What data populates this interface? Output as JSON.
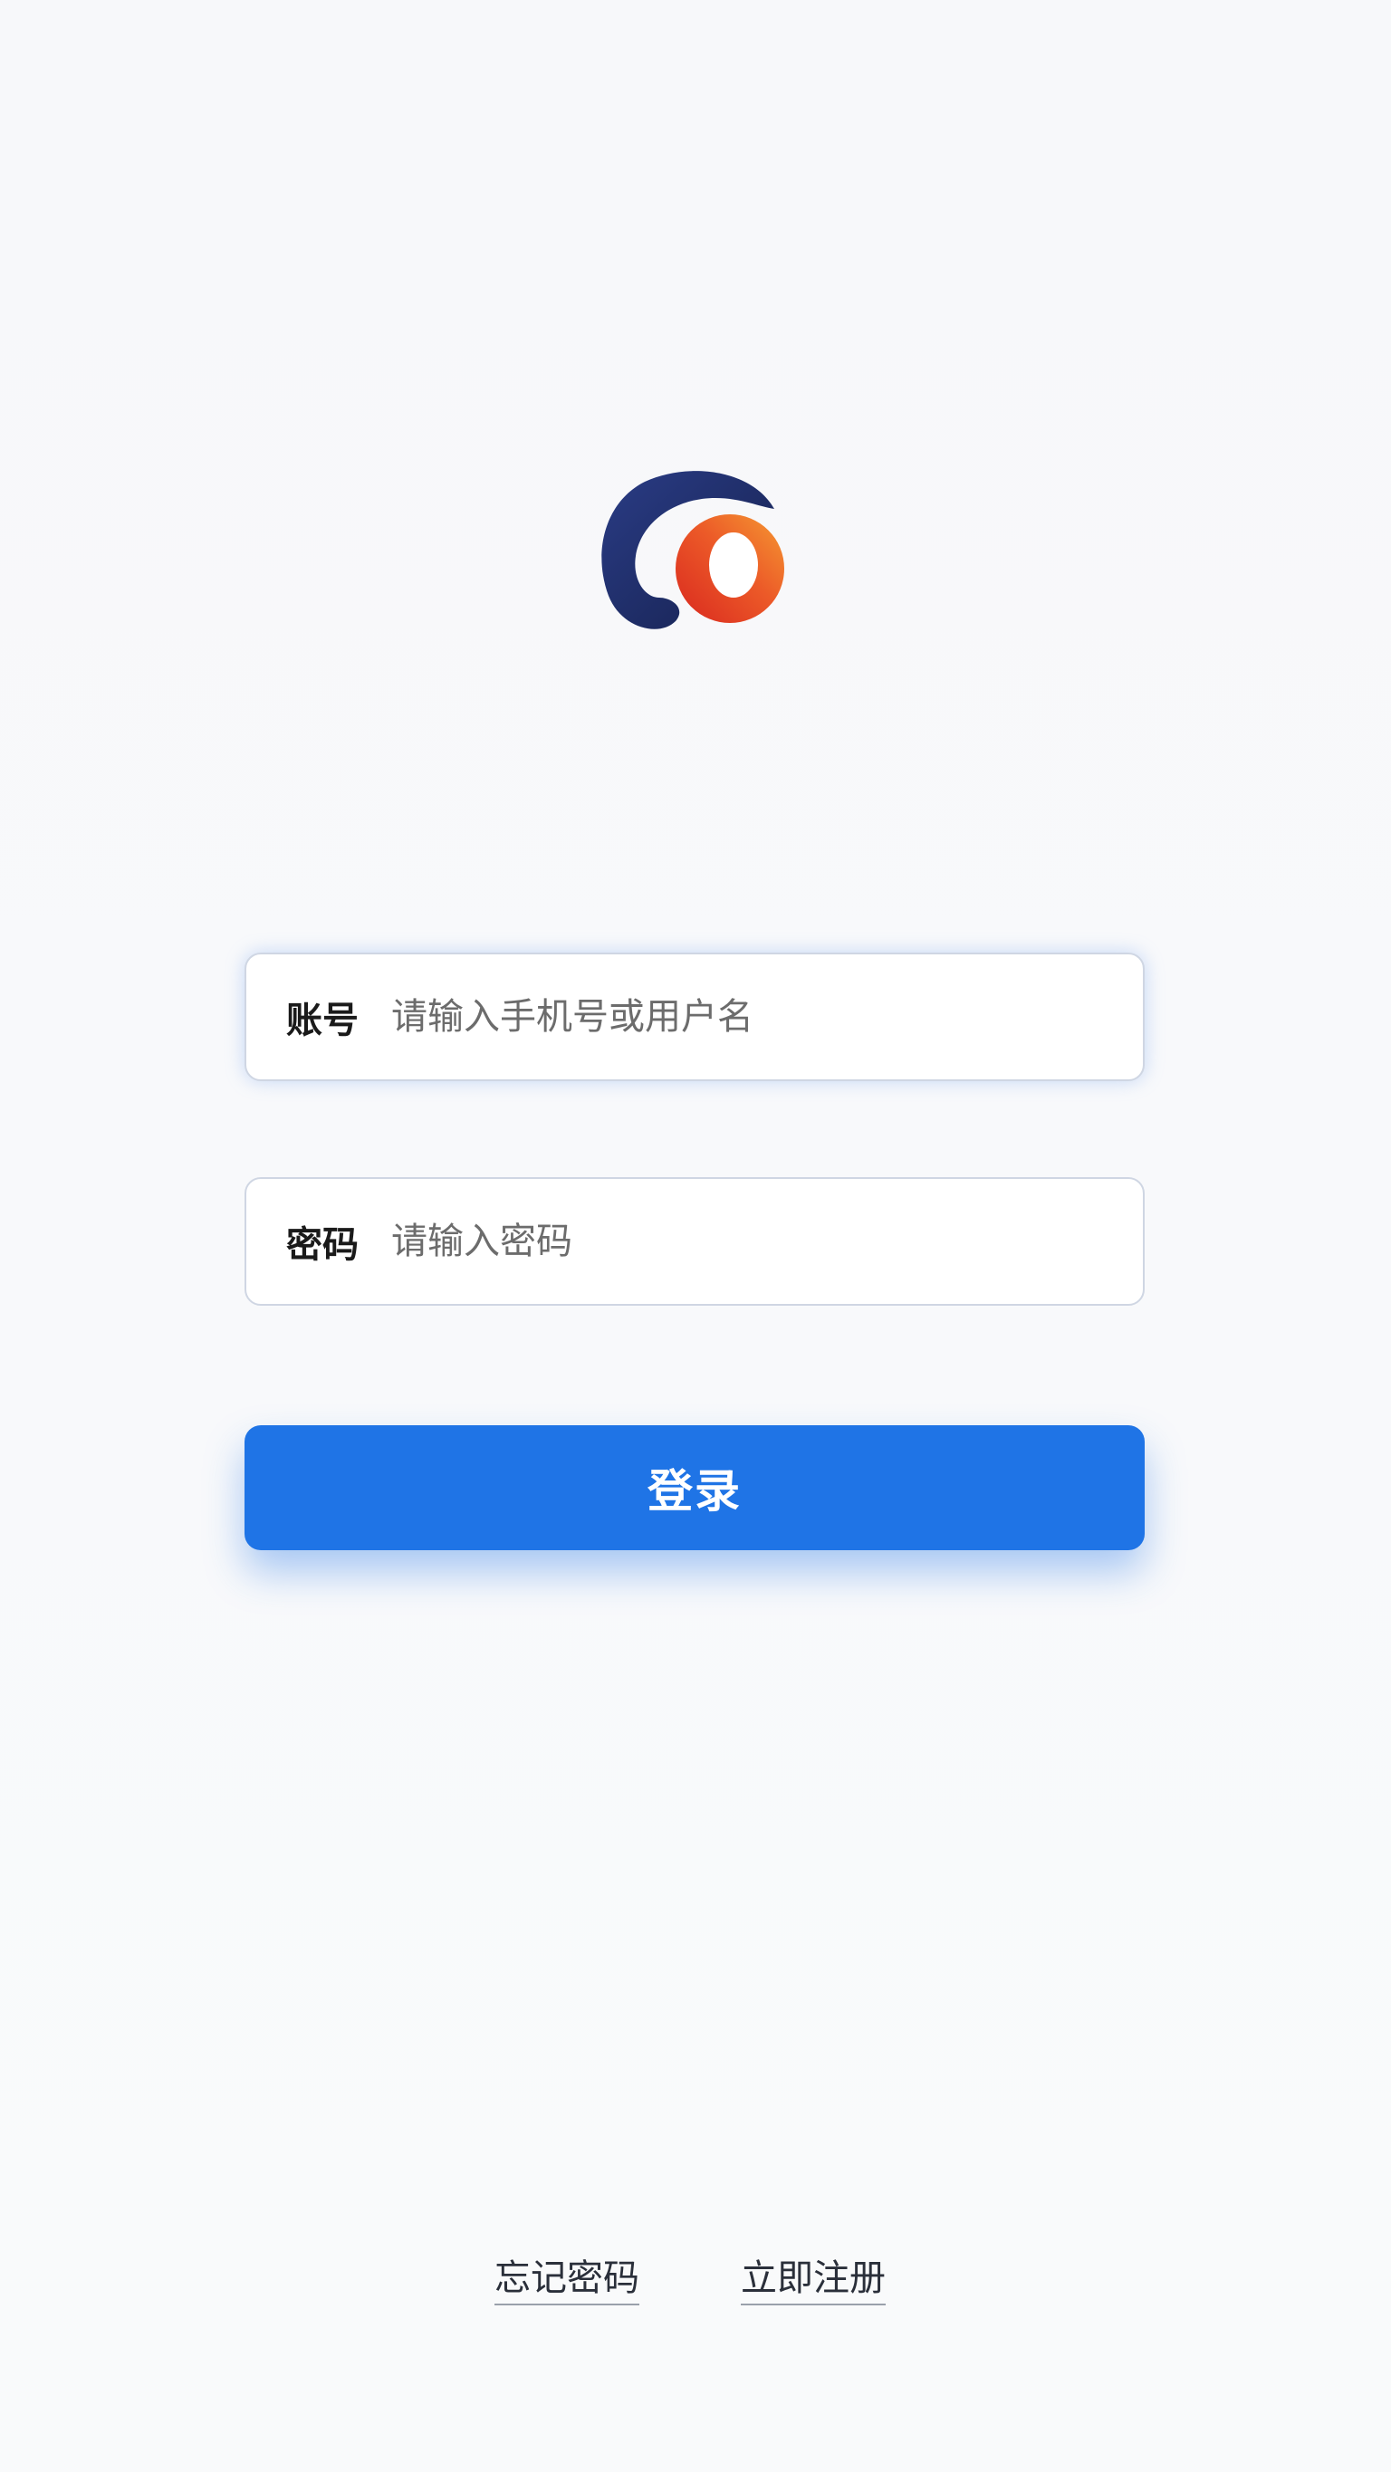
{
  "logo": {
    "name": "app-logo",
    "colors": {
      "navy": "#1e2d6b",
      "red": "#e23b2a",
      "orange": "#f08a2a"
    }
  },
  "form": {
    "account": {
      "label": "账号",
      "placeholder": "请输入手机号或用户名",
      "value": ""
    },
    "password": {
      "label": "密码",
      "placeholder": "请输入密码",
      "value": ""
    },
    "login_label": "登录"
  },
  "links": {
    "forgot_password": "忘记密码",
    "register": "立即注册"
  },
  "colors": {
    "primary": "#1f74e6",
    "background": "#f8f9fb",
    "field_border": "#cfd6e3"
  }
}
